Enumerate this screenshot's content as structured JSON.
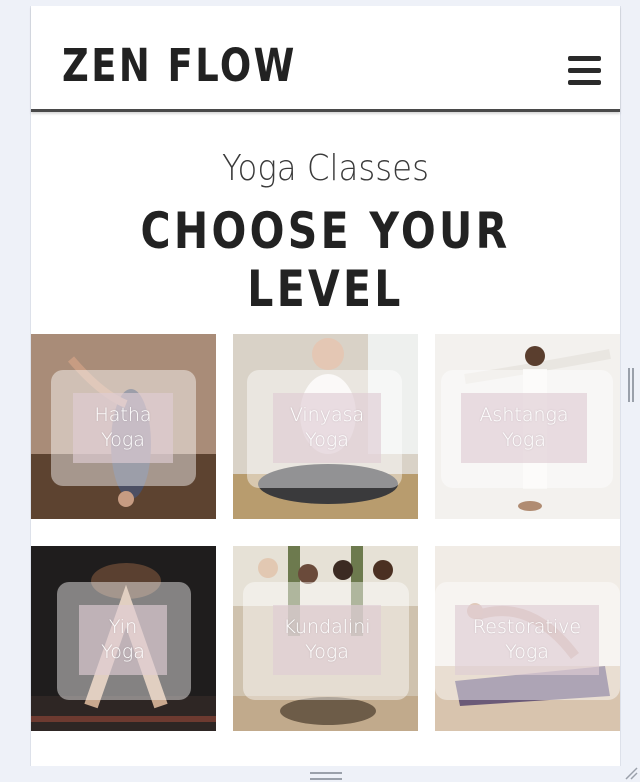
{
  "header": {
    "logo": "ZEN FLOW",
    "menu_icon": "hamburger-menu-icon"
  },
  "hero": {
    "subtitle": "Yoga Classes",
    "title": "CHOOSE YOUR LEVEL"
  },
  "classes": [
    {
      "line1": "Hatha",
      "line2": "Yoga",
      "tone": "#8a6a55"
    },
    {
      "line1": "Vinyasa",
      "line2": "Yoga",
      "tone": "#cfc8bd"
    },
    {
      "line1": "Ashtanga",
      "line2": "Yoga",
      "tone": "#f1efec"
    },
    {
      "line1": "Yin",
      "line2": "Yoga",
      "tone": "#1e1c1c"
    },
    {
      "line1": "Kundalini",
      "line2": "Yoga",
      "tone": "#b8a58a"
    },
    {
      "line1": "Restorative",
      "line2": "Yoga",
      "tone": "#ece6df"
    }
  ]
}
